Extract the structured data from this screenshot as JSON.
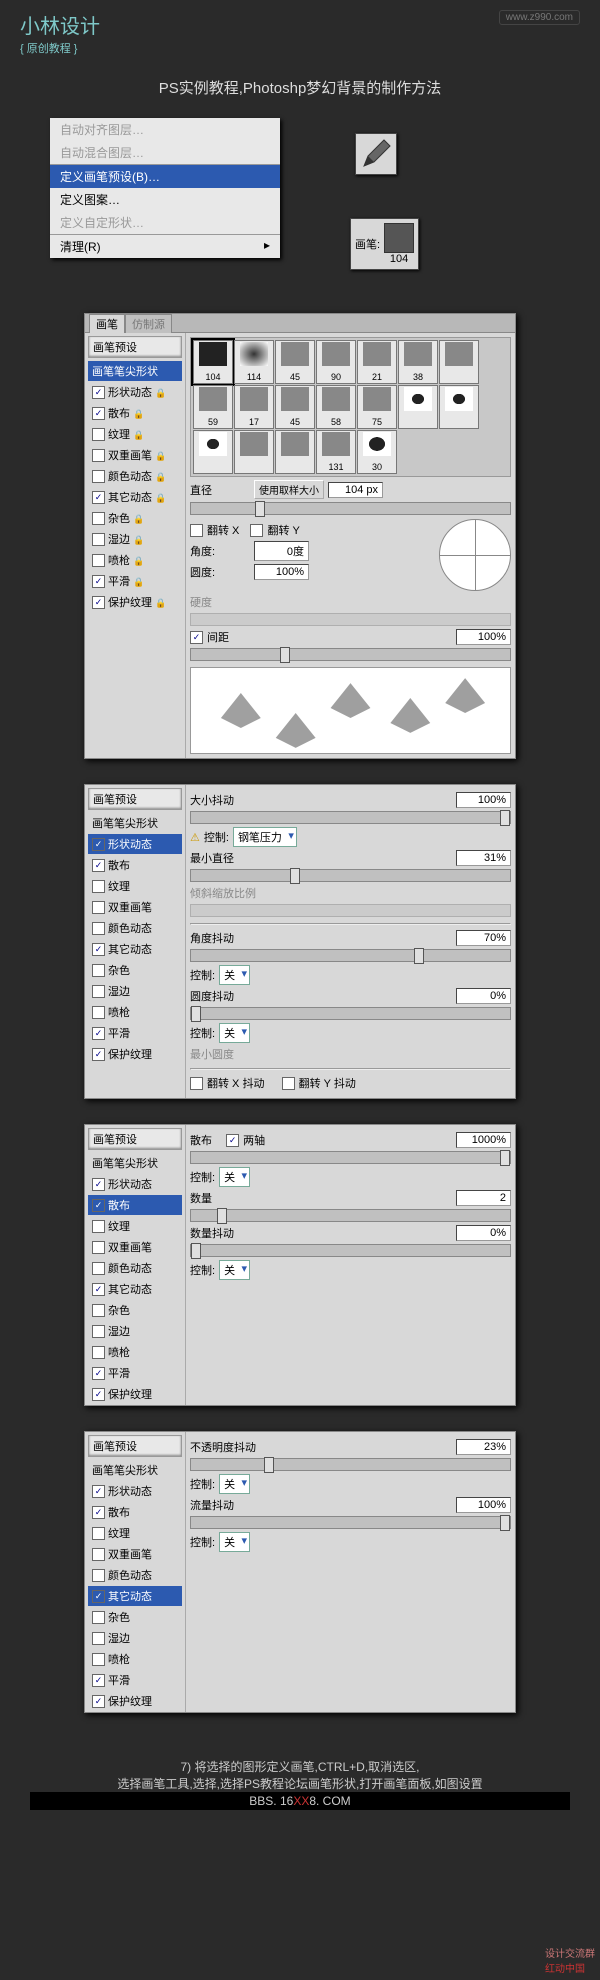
{
  "header": {
    "logo": "小林设计",
    "logo_sub": "{ 原创教程 }",
    "url": "www.z990.com"
  },
  "title": "PS实例教程,Photoshp梦幻背景的制作方法",
  "menu": {
    "auto_align": "自动对齐图层…",
    "auto_blend": "自动混合图层…",
    "define_brush": "定义画笔预设(B)…",
    "define_pattern": "定义图案…",
    "define_shape": "定义自定形状…",
    "purge": "清理(R)"
  },
  "brush_toolbar": {
    "label": "画笔:",
    "size": "104"
  },
  "panel_labels": {
    "tab_brush": "画笔",
    "tab_clone": "仿制源",
    "preset_head": "画笔预设",
    "items": {
      "tip": "画笔笔尖形状",
      "shape": "形状动态",
      "scatter": "散布",
      "texture": "纹理",
      "dual": "双重画笔",
      "color": "颜色动态",
      "other": "其它动态",
      "noise": "杂色",
      "wet": "湿边",
      "airbrush": "喷枪",
      "smooth": "平滑",
      "protect": "保护纹理"
    }
  },
  "tip_panel": {
    "thumbs": [
      "104",
      "114",
      "45",
      "90",
      "21",
      "38",
      "",
      "59",
      "17",
      "45",
      "58",
      "75",
      "",
      "",
      "",
      "",
      "",
      "131",
      "30"
    ],
    "diameter_label": "直径",
    "use_sample": "使用取样大小",
    "diameter_val": "104 px",
    "flipx": "翻转 X",
    "flipy": "翻转 Y",
    "angle_label": "角度:",
    "angle_val": "0度",
    "round_label": "圆度:",
    "round_val": "100%",
    "hardness_label": "硬度",
    "spacing_label": "间距",
    "spacing_val": "100%"
  },
  "shape_panel": {
    "size_jitter_label": "大小抖动",
    "size_jitter_val": "100%",
    "control_label": "控制:",
    "pen_pressure": "钢笔压力",
    "min_dia_label": "最小直径",
    "min_dia_val": "31%",
    "tilt_scale_label": "倾斜缩放比例",
    "angle_jitter_label": "角度抖动",
    "angle_jitter_val": "70%",
    "control_off": "关",
    "round_jitter_label": "圆度抖动",
    "round_jitter_val": "0%",
    "min_round_label": "最小圆度",
    "flipx_jitter": "翻转 X 抖动",
    "flipy_jitter": "翻转 Y 抖动"
  },
  "scatter_panel": {
    "scatter_label": "散布",
    "both_axes": "两轴",
    "scatter_val": "1000%",
    "control_label": "控制:",
    "control_off": "关",
    "count_label": "数量",
    "count_val": "2",
    "count_jitter_label": "数量抖动",
    "count_jitter_val": "0%"
  },
  "other_panel": {
    "opacity_jitter_label": "不透明度抖动",
    "opacity_jitter_val": "23%",
    "control_label": "控制:",
    "control_off": "关",
    "flow_jitter_label": "流量抖动",
    "flow_jitter_val": "100%"
  },
  "footer": {
    "step": "7) 将选择的图形定义画笔,CTRL+D,取消选区,",
    "line2a": "选择画笔工具,选择,选择",
    "line2b": "PS教程论坛",
    "line2c": "画笔形状,打开画笔面板,如图设置",
    "bbs": "BBS. 16",
    "bbs_red": "XX",
    "bbs2": "8. COM",
    "corner": "设计交流群",
    "corner2": "红动中国"
  }
}
